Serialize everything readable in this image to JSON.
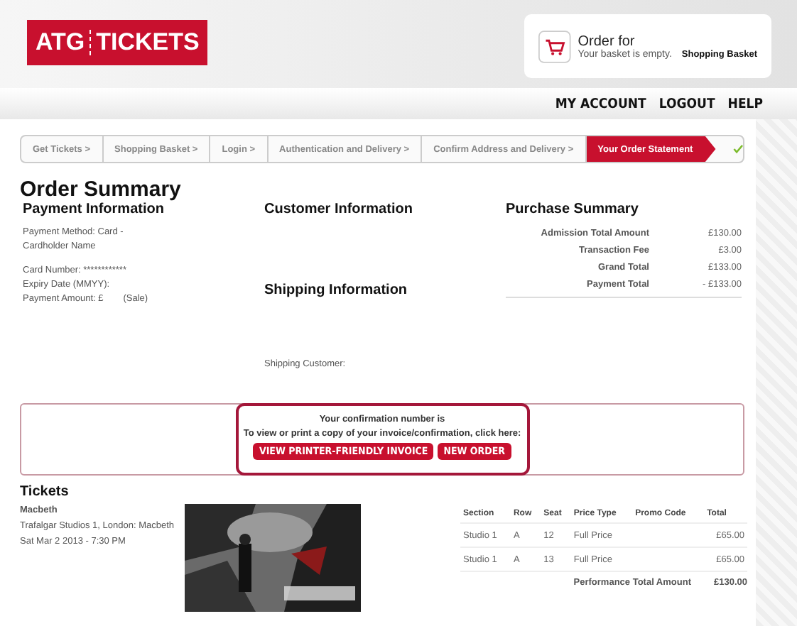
{
  "logo": {
    "left": "ATG",
    "right": "TICKETS"
  },
  "basket": {
    "title": "Order for",
    "status": "Your basket is empty.",
    "link": "Shopping Basket"
  },
  "nav": [
    "MY ACCOUNT",
    "LOGOUT",
    "HELP"
  ],
  "steps": [
    {
      "label": "Get Tickets >",
      "selected": false
    },
    {
      "label": "Shopping Basket >",
      "selected": false
    },
    {
      "label": "Login >",
      "selected": false
    },
    {
      "label": "Authentication and Delivery >",
      "selected": false
    },
    {
      "label": "Confirm Address and Delivery >",
      "selected": false
    },
    {
      "label": "Your Order Statement",
      "selected": true
    }
  ],
  "steps_complete": true,
  "title": "Order Summary",
  "payment": {
    "heading": "Payment Information",
    "lines": [
      "Payment Method: Card - Cardholder Name",
      "Card Number: ************",
      "Expiry Date (MMYY):",
      "Payment Amount: £"
    ],
    "sale": "(Sale)"
  },
  "customer": {
    "heading": "Customer Information"
  },
  "shipping": {
    "heading": "Shipping Information",
    "customer_label": "Shipping Customer:"
  },
  "purchase": {
    "heading": "Purchase Summary",
    "rows": [
      {
        "label": "Admission Total Amount",
        "value": "£130.00"
      },
      {
        "label": "Transaction Fee",
        "value": "£3.00"
      },
      {
        "label": "Grand Total",
        "value": "£133.00"
      },
      {
        "label": "Payment Total",
        "value": "- £133.00"
      }
    ]
  },
  "confirmation": {
    "number_text": "Your confirmation number is",
    "instructions": "To view or print a copy of your invoice/confirmation, click here:",
    "buttons": [
      "VIEW PRINTER-FRIENDLY INVOICE",
      "NEW ORDER"
    ]
  },
  "tickets": {
    "heading": "Tickets",
    "show": "Macbeth",
    "venue": "Trafalgar Studios 1, London: Macbeth",
    "date": "Sat Mar 2 2013 - 7:30 PM",
    "columns": [
      "Section",
      "Row",
      "Seat",
      "Price Type",
      "Promo Code",
      "Total"
    ],
    "rows": [
      [
        "Studio 1",
        "A",
        "12",
        "Full Price",
        "",
        "£65.00"
      ],
      [
        "Studio 1",
        "A",
        "13",
        "Full Price",
        "",
        "£65.00"
      ]
    ],
    "total_label": "Performance Total Amount",
    "total_value": "£130.00"
  }
}
